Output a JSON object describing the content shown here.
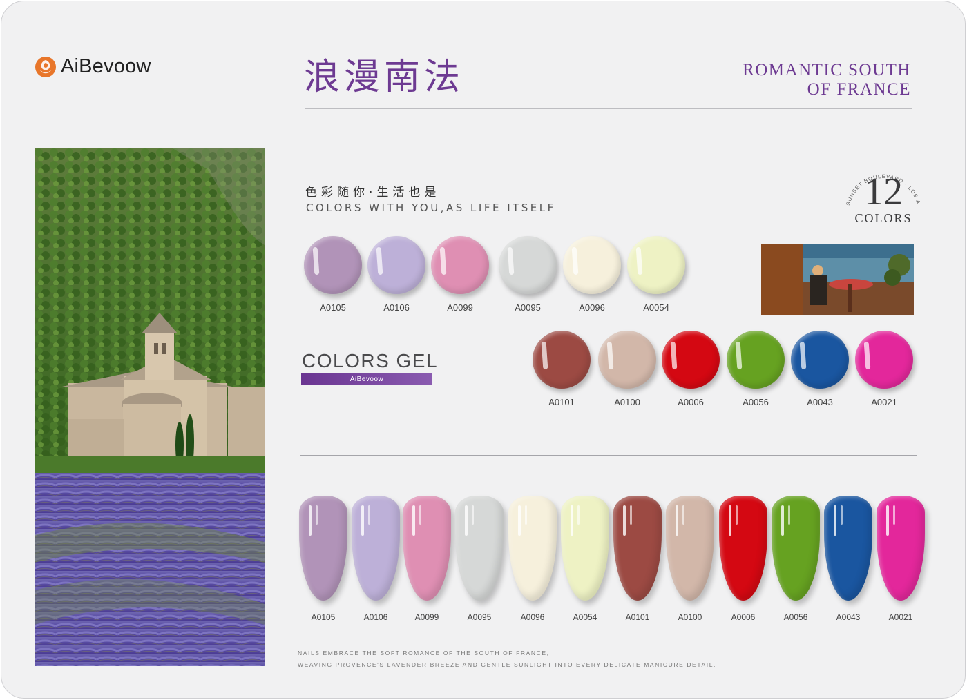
{
  "brand": {
    "name": "AiBevoow",
    "accent": "#e8762a"
  },
  "header": {
    "title_cn": "浪漫南法",
    "title_en_line1": "ROMANTIC SOUTH",
    "title_en_line2": "OF FRANCE",
    "accent": "#6d3a92"
  },
  "slogan": {
    "cn": "色彩随你·生活也是",
    "en": "COLORS WITH YOU,AS LIFE ITSELF"
  },
  "badge": {
    "arc_text": "SUNSET BOULEVARD · LOS ANGELES",
    "number": "12",
    "word": "COLORS"
  },
  "gel": {
    "title": "COLORS GEL",
    "bar_label": "AiBevoow"
  },
  "swatches_row1": [
    {
      "code": "A0105",
      "color": "#b193b8"
    },
    {
      "code": "A0106",
      "color": "#bdb0d8"
    },
    {
      "code": "A0099",
      "color": "#df8fb3"
    },
    {
      "code": "A0095",
      "color": "#d6d8d7"
    },
    {
      "code": "A0096",
      "color": "#f6f0dc"
    },
    {
      "code": "A0054",
      "color": "#eef2c4"
    }
  ],
  "swatches_row2": [
    {
      "code": "A0101",
      "color": "#9c4a43"
    },
    {
      "code": "A0100",
      "color": "#d2b7a9"
    },
    {
      "code": "A0006",
      "color": "#d40812"
    },
    {
      "code": "A0056",
      "color": "#66a221"
    },
    {
      "code": "A0043",
      "color": "#1a56a0"
    },
    {
      "code": "A0021",
      "color": "#e3279b"
    }
  ],
  "nails": [
    {
      "code": "A0105",
      "color": "#b193b8"
    },
    {
      "code": "A0106",
      "color": "#bdb0d8"
    },
    {
      "code": "A0099",
      "color": "#df8fb3"
    },
    {
      "code": "A0095",
      "color": "#d6d8d7"
    },
    {
      "code": "A0096",
      "color": "#f6f0dc"
    },
    {
      "code": "A0054",
      "color": "#eef2c4"
    },
    {
      "code": "A0101",
      "color": "#9c4a43"
    },
    {
      "code": "A0100",
      "color": "#d2b7a9"
    },
    {
      "code": "A0006",
      "color": "#d40812"
    },
    {
      "code": "A0056",
      "color": "#66a221"
    },
    {
      "code": "A0043",
      "color": "#1a56a0"
    },
    {
      "code": "A0021",
      "color": "#e3279b"
    }
  ],
  "footer": {
    "line1": "NAILS EMBRACE THE SOFT ROMANCE OF THE SOUTH OF FRANCE,",
    "line2": "WEAVING PROVENCE'S LAVENDER BREEZE AND GENTLE SUNLIGHT INTO EVERY DELICATE MANICURE DETAIL."
  }
}
